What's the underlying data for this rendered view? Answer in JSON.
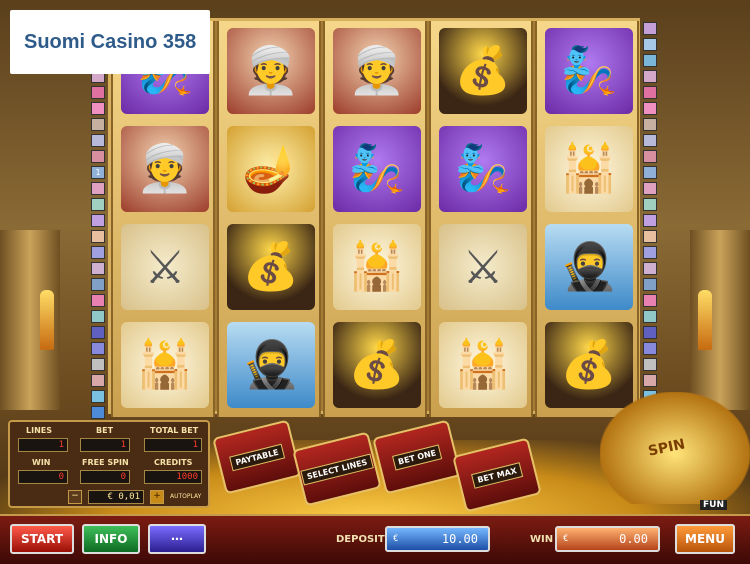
{
  "badge": {
    "text": "Suomi Casino 358"
  },
  "reels": [
    [
      "genie",
      "sultan",
      "swords",
      "palace"
    ],
    [
      "sultan",
      "lamp",
      "gold",
      "villain"
    ],
    [
      "sultan",
      "genie",
      "palace",
      "gold"
    ],
    [
      "gold",
      "genie",
      "swords",
      "palace"
    ],
    [
      "genie",
      "palace",
      "villain",
      "gold"
    ]
  ],
  "symbol_icons": {
    "genie": "🧞",
    "sultan": "👳",
    "lamp": "🪔",
    "gold": "💰",
    "palace": "🕌",
    "swords": "⚔",
    "villain": "🥷"
  },
  "panel": {
    "lines_label": "LINES",
    "lines_value": "1",
    "bet_label": "BET",
    "bet_value": "1",
    "total_bet_label": "TOTAL BET",
    "total_bet_value": "1",
    "win_label": "WIN",
    "win_value": "0",
    "free_spin_label": "FREE SPIN",
    "free_spin_value": "0",
    "credits_label": "CREDITS",
    "credits_value": "1000",
    "coin_value": "€ 0,01",
    "minus": "−",
    "plus": "+",
    "autoplay": "AUTOPLAY"
  },
  "chests": {
    "paytable": "PAYTABLE",
    "select_lines": "SELECT LINES",
    "bet_one": "BET ONE",
    "bet_max": "BET MAX"
  },
  "lamp_label": "SPIN",
  "fun_label": "FUN",
  "line_marker": "1",
  "bottom": {
    "start": "START",
    "info": "INFO",
    "lines_icon": "⋯",
    "deposit_label": "DEPOSIT",
    "deposit_currency": "€",
    "deposit_value": "10.00",
    "win_label": "WIN",
    "win_currency": "€",
    "win_value": "0.00",
    "menu": "MENU"
  },
  "colors": {
    "line_colors": [
      "#c5a0d8",
      "#a8c8e8",
      "#7ab6d8",
      "#d4a8c8",
      "#e070a0",
      "#f090c0",
      "#c8b0a0",
      "#b8b8d8",
      "#d890a0",
      "#90b0d8",
      "#e0a0c0",
      "#a0d0c0",
      "#c0a0e0",
      "#e8c0a0",
      "#a0a0e0",
      "#d0b0d0",
      "#80a0c8",
      "#e880b0",
      "#90c8c8",
      "#6060c0",
      "#8888dd",
      "#c0c0c0",
      "#d8a8a8",
      "#7ac0e0",
      "#4d8ad8"
    ]
  }
}
